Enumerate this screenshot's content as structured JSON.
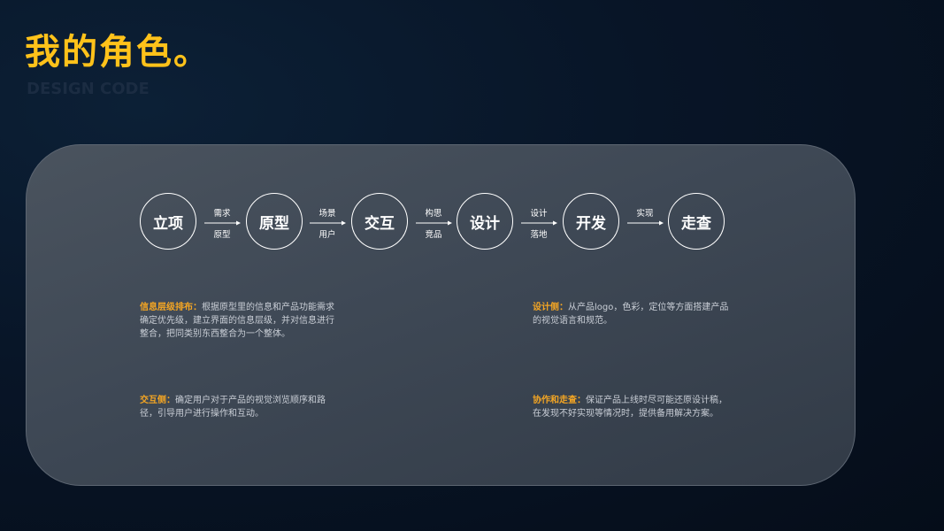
{
  "page": {
    "title": "我的角色。",
    "subtitle": "DESIGN CODE"
  },
  "flow": {
    "steps": [
      "立项",
      "原型",
      "交互",
      "设计",
      "开发",
      "走查"
    ],
    "connectors": [
      {
        "top": "需求",
        "bottom": "原型"
      },
      {
        "top": "场景",
        "bottom": "用户"
      },
      {
        "top": "构思",
        "bottom": "竞品"
      },
      {
        "top": "设计",
        "bottom": "落地"
      },
      {
        "top": "实现",
        "bottom": ""
      }
    ]
  },
  "descriptions": [
    {
      "key": "信息层级排布：",
      "text": "根据原型里的信息和产品功能需求确定优先级，建立界面的信息层级，并对信息进行整合，把同类别东西整合为一个整体。"
    },
    {
      "key": "设计侧：",
      "text": "从产品logo，色彩，定位等方面搭建产品的视觉语言和规范。"
    },
    {
      "key": "交互侧：",
      "text": "确定用户对于产品的视觉浏览顺序和路径，引导用户进行操作和互动。"
    },
    {
      "key": "协作和走查：",
      "text": "保证产品上线时尽可能还原设计稿，在发现不好实现等情况时，提供备用解决方案。"
    }
  ],
  "colors": {
    "accent": "#ffc21a",
    "key_label": "#f5a623",
    "panel": "#3e4855",
    "background": "#081527"
  }
}
